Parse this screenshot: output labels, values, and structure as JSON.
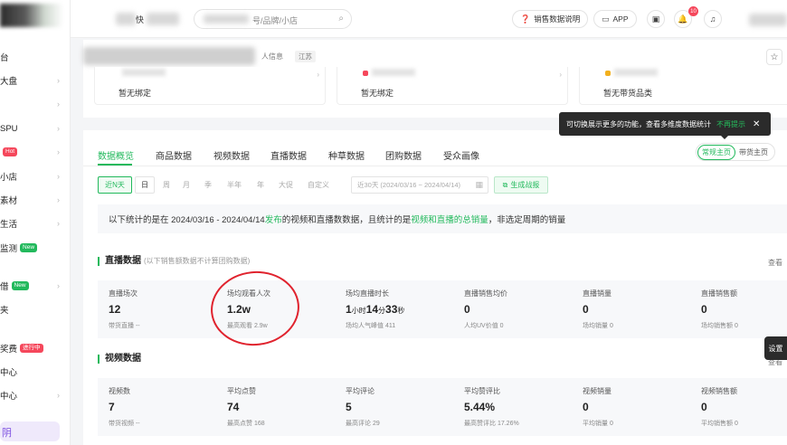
{
  "sidebar": {
    "items": [
      {
        "label": "台",
        "badge": "",
        "chevron": false
      },
      {
        "label": "大盘",
        "badge": "",
        "chevron": true
      },
      {
        "label": "",
        "badge": "",
        "chevron": true
      },
      {
        "label": "SPU",
        "badge": "",
        "chevron": true
      },
      {
        "label": "",
        "badge": "Hot",
        "chevron": true
      },
      {
        "label": "小店",
        "badge": "",
        "chevron": true
      },
      {
        "label": "素材",
        "badge": "",
        "chevron": true
      },
      {
        "label": "生活",
        "badge": "",
        "chevron": true
      },
      {
        "label": "监测",
        "badge": "New",
        "chevron": false
      },
      {
        "label": "借",
        "badge": "New",
        "chevron": true
      },
      {
        "label": "夹",
        "badge": "",
        "chevron": false
      },
      {
        "label": "奖费",
        "badge": "进行中",
        "chevron": false
      },
      {
        "label": "中心",
        "badge": "",
        "chevron": false
      },
      {
        "label": "中心",
        "badge": "",
        "chevron": true
      }
    ],
    "bottom_label": "阴"
  },
  "topbar": {
    "brand_partial": "快",
    "search_placeholder": "号/品牌/小店",
    "sales_explain": "销售数据说明",
    "app": "APP",
    "notification_count": "10"
  },
  "header": {
    "info_label": "人信息",
    "region": "江苏",
    "cards": [
      {
        "value": "暂无绑定"
      },
      {
        "value": "暂无绑定"
      },
      {
        "value": "暂无带货品类"
      }
    ]
  },
  "tooltip": {
    "text": "可切换展示更多的功能，查看多维度数据统计",
    "action": "不再提示"
  },
  "tabs": [
    "数据概览",
    "商品数据",
    "视频数据",
    "直播数据",
    "种草数据",
    "团购数据",
    "受众画像"
  ],
  "active_tab": 0,
  "view_toggle": {
    "on": "常规主页",
    "off": "带货主页"
  },
  "date_filters": [
    "近N天",
    "日",
    "周",
    "月",
    "季",
    "半年",
    "年",
    "大促",
    "自定义"
  ],
  "date_range": "近30天 (2024/03/16 ~ 2024/04/14)",
  "generate_button": "生成战报",
  "notice": {
    "p1": "以下统计的是在 2024/03/16 - 2024/04/14 ",
    "hl1": "发布",
    "p2": "的视频和直播数数据，且统计的是",
    "hl2": "视频和直播的总销量",
    "p3": "，非选定周期的销量"
  },
  "live_section": {
    "title": "直播数据",
    "note": "(以下销售额数据不计算团购数据)",
    "more": "查看",
    "stats": [
      {
        "label": "直播场次",
        "value": "12",
        "sub": "带货直播 --"
      },
      {
        "label": "场均观看人次",
        "value": "1.2w",
        "sub": "最高观看 2.9w"
      },
      {
        "label": "场均直播时长",
        "value_h": "1",
        "unit_h": "小时",
        "value_m": "14",
        "unit_m": "分",
        "value_s": "33",
        "unit_s": "秒",
        "sub": "场均人气峰值 411"
      },
      {
        "label": "直播销售均价",
        "value": "0",
        "sub": "人均UV价值 0"
      },
      {
        "label": "直播销量",
        "value": "0",
        "sub": "场均销量 0"
      },
      {
        "label": "直播销售额",
        "value": "0",
        "sub": "场均销售额 0"
      }
    ]
  },
  "video_section": {
    "title": "视频数据",
    "more": "查看",
    "stats": [
      {
        "label": "视频数",
        "value": "7",
        "sub": "带货视频 --"
      },
      {
        "label": "平均点赞",
        "value": "74",
        "sub": "最高点赞 168"
      },
      {
        "label": "平均评论",
        "value": "5",
        "sub": "最高评论 29"
      },
      {
        "label": "平均赞评比",
        "value": "5.44%",
        "sub": "最高赞评比 17.26%"
      },
      {
        "label": "视频销量",
        "value": "0",
        "sub": "平均销量 0"
      },
      {
        "label": "视频销售额",
        "value": "0",
        "sub": "平均销售额 0"
      }
    ]
  },
  "settings_tab": "设置",
  "colors": {
    "accent": "#22b95c",
    "annotation": "#e0232e",
    "hot": "#f5475b"
  }
}
